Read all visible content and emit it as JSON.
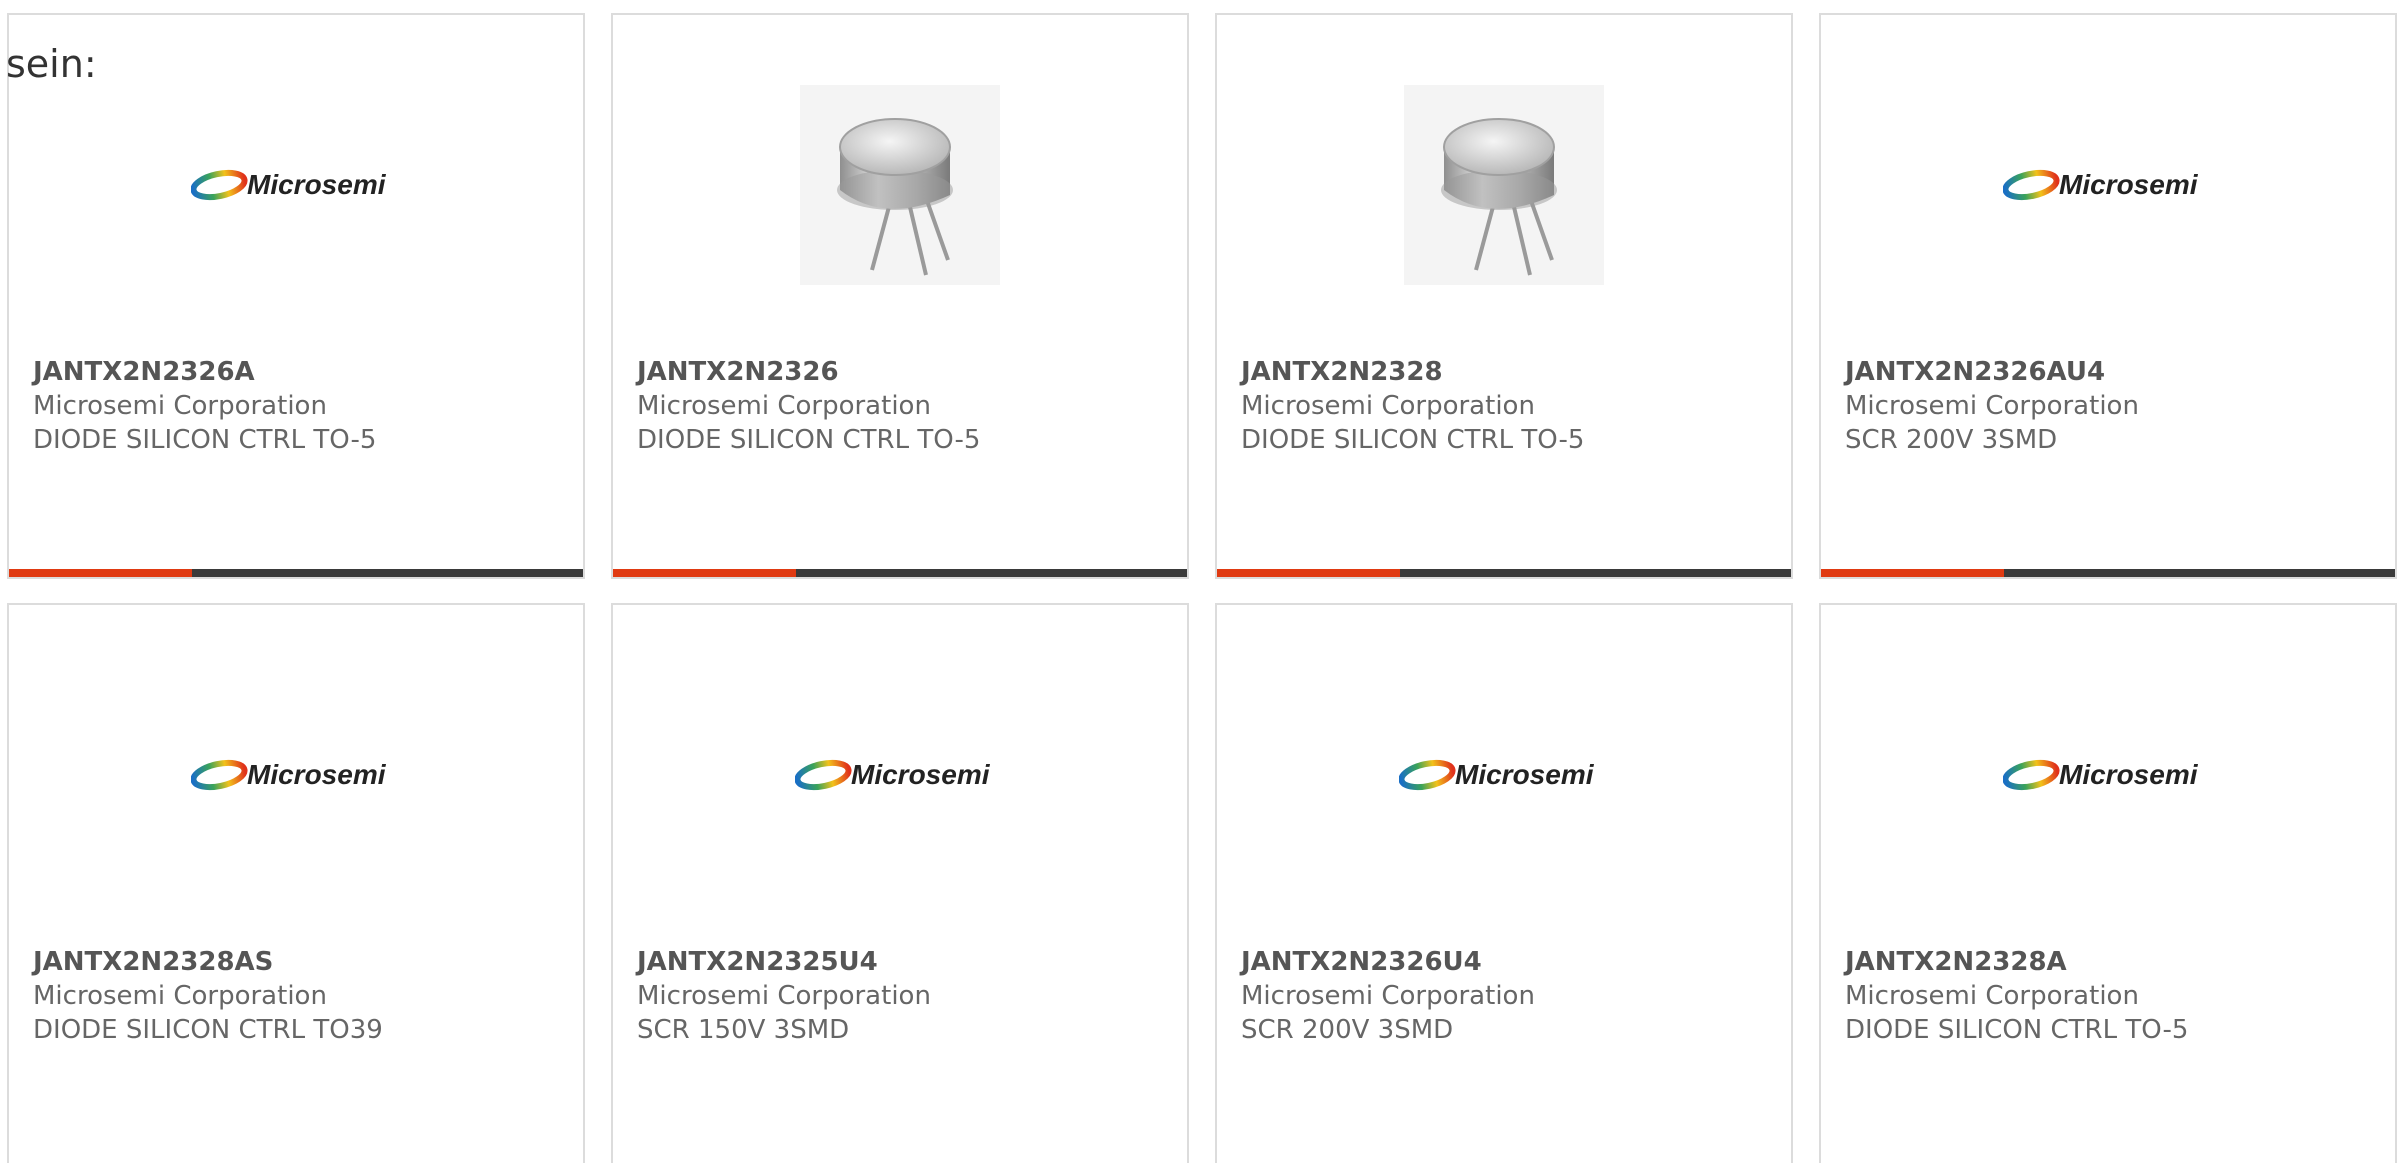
{
  "intro": {
    "text": "sein:"
  },
  "brand": {
    "logo_text": "Microsemi",
    "colors": {
      "accent": "#e03a12",
      "bar": "#3a3a3a",
      "border": "#dcdcdc",
      "text_dark": "#555555",
      "text_light": "#666666"
    }
  },
  "products": [
    {
      "part_number": "JANTX2N2326A",
      "manufacturer": "Microsemi Corporation",
      "description": "DIODE SILICON CTRL TO-5",
      "image": "microsemi-logo",
      "has_bar": true
    },
    {
      "part_number": "JANTX2N2326",
      "manufacturer": "Microsemi Corporation",
      "description": "DIODE SILICON CTRL TO-5",
      "image": "to5-package-photo",
      "has_bar": true
    },
    {
      "part_number": "JANTX2N2328",
      "manufacturer": "Microsemi Corporation",
      "description": "DIODE SILICON CTRL TO-5",
      "image": "to5-package-photo",
      "has_bar": true
    },
    {
      "part_number": "JANTX2N2326AU4",
      "manufacturer": "Microsemi Corporation",
      "description": "SCR 200V 3SMD",
      "image": "microsemi-logo",
      "has_bar": true
    },
    {
      "part_number": "JANTX2N2328AS",
      "manufacturer": "Microsemi Corporation",
      "description": "DIODE SILICON CTRL TO39",
      "image": "microsemi-logo",
      "has_bar": false
    },
    {
      "part_number": "JANTX2N2325U4",
      "manufacturer": "Microsemi Corporation",
      "description": "SCR 150V 3SMD",
      "image": "microsemi-logo",
      "has_bar": false
    },
    {
      "part_number": "JANTX2N2326U4",
      "manufacturer": "Microsemi Corporation",
      "description": "SCR 200V 3SMD",
      "image": "microsemi-logo",
      "has_bar": false
    },
    {
      "part_number": "JANTX2N2328A",
      "manufacturer": "Microsemi Corporation",
      "description": "DIODE SILICON CTRL TO-5",
      "image": "microsemi-logo",
      "has_bar": false
    }
  ]
}
